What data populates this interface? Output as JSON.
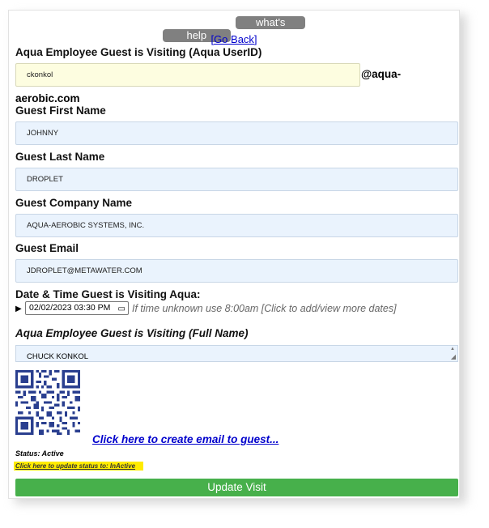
{
  "toolbar": {
    "help_label": "help",
    "whatsnew_label": "what's new?"
  },
  "nav": {
    "go_back": "[Go Back]"
  },
  "employee_userid": {
    "label": "Aqua Employee Guest is Visiting (Aqua UserID)",
    "value": "ckonkol",
    "domain_part1": "@aqua-",
    "domain_part2": "aerobic.com"
  },
  "first_name": {
    "label": "Guest First Name",
    "value": "JOHNNY"
  },
  "last_name": {
    "label": "Guest Last Name",
    "value": "DROPLET"
  },
  "company": {
    "label": "Guest Company Name",
    "value": "AQUA-AEROBIC SYSTEMS, INC."
  },
  "email": {
    "label": "Guest Email",
    "value": "JDROPLET@METAWATER.COM"
  },
  "visit_date": {
    "label": "Date & Time Guest is Visiting Aqua:",
    "value": "02/02/2023 03:30 PM",
    "hint": "If time unknown use 8:00am [Click to add/view more dates]"
  },
  "employee_fullname": {
    "label": "Aqua Employee Guest is Visiting (Full Name)",
    "value": "CHUCK KONKOL"
  },
  "email_guest_link": "Click here to create email to guest...",
  "status": {
    "text": "Status: Active",
    "update_link": "Click here to update status to: InActive"
  },
  "submit": {
    "label": "Update Visit"
  },
  "icons": {
    "calendar": "calendar-icon",
    "expand": "triangle-right-icon",
    "qr": "qr-code-icon"
  }
}
